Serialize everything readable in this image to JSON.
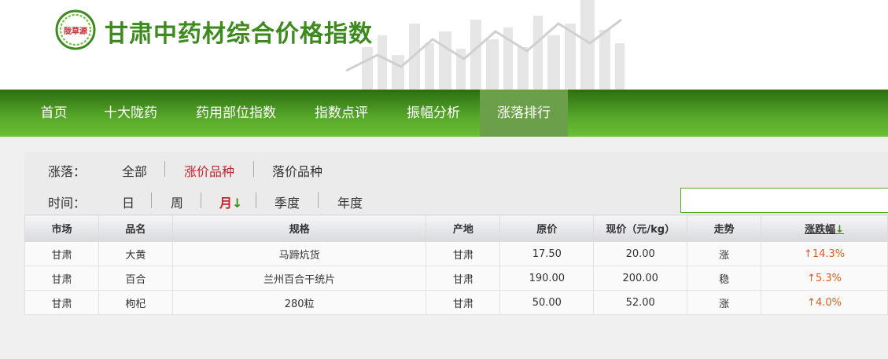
{
  "header": {
    "title": "甘肃中药材综合价格指数",
    "logo_text": "陇草源"
  },
  "nav": {
    "items": [
      "首页",
      "十大陇药",
      "药用部位指数",
      "指数点评",
      "振幅分析",
      "涨落排行"
    ],
    "active_index": 5
  },
  "filters": {
    "rise_fall_label": "涨落：",
    "rise_fall_options": [
      "全部",
      "涨价品种",
      "落价品种"
    ],
    "rise_fall_selected": "涨价品种",
    "time_label": "时间：",
    "time_options": [
      "日",
      "周",
      "月",
      "季度",
      "年度"
    ],
    "time_selected": "月",
    "time_sort_arrow": "↓"
  },
  "table": {
    "headers": [
      "市场",
      "品名",
      "规格",
      "产地",
      "原价",
      "现价（元/kg）",
      "走势",
      "涨跌幅"
    ],
    "sort_arrow": "↓",
    "rows": [
      {
        "market": "甘肃",
        "name": "大黄",
        "spec": "马蹄炕货",
        "origin": "甘肃",
        "old_price": "17.50",
        "new_price": "20.00",
        "trend": "涨",
        "change": "↑14.3%"
      },
      {
        "market": "甘肃",
        "name": "百合",
        "spec": "兰州百合干统片",
        "origin": "甘肃",
        "old_price": "190.00",
        "new_price": "200.00",
        "trend": "稳",
        "change": "↑5.3%"
      },
      {
        "market": "甘肃",
        "name": "枸杞",
        "spec": "280粒",
        "origin": "甘肃",
        "old_price": "50.00",
        "new_price": "52.00",
        "trend": "涨",
        "change": "↑4.0%"
      }
    ]
  },
  "colors": {
    "brand_green": "#3d8a1f",
    "nav_active": "#6c9f4a",
    "accent_red": "#c8262d",
    "rise_orange": "#e15b1f"
  }
}
